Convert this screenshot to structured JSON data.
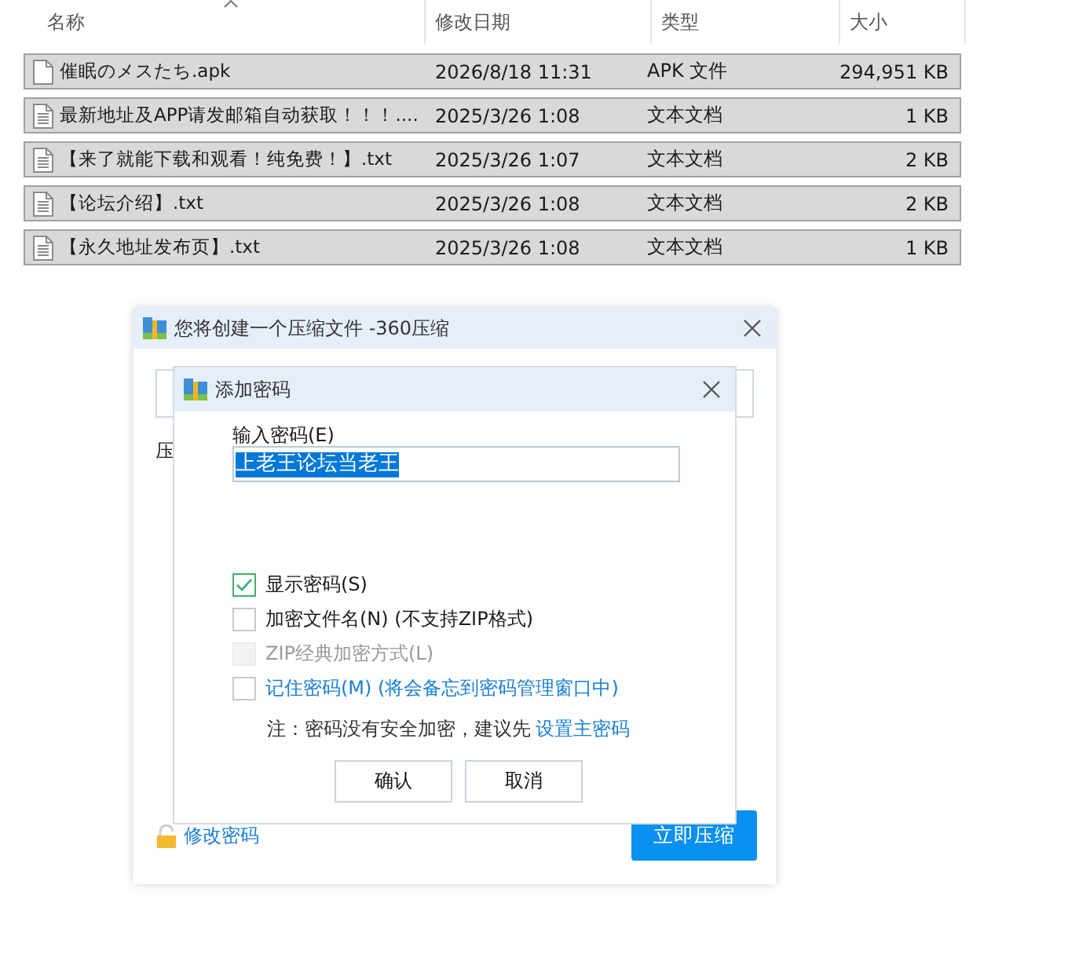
{
  "file_list": {
    "columns": [
      "名称",
      "修改日期",
      "类型",
      "大小"
    ],
    "rows": [
      {
        "name": "催眠のメスたち.apk",
        "date": "2026/8/18 11:31",
        "type": "APK 文件",
        "size": "294,951 KB",
        "selected": true,
        "kind": "blank"
      },
      {
        "name": "最新地址及APP请发邮箱自动获取！！！....",
        "date": "2025/3/26 1:08",
        "type": "文本文档",
        "size": "1 KB",
        "selected": true,
        "kind": "text"
      },
      {
        "name": "【来了就能下载和观看！纯免费！】.txt",
        "date": "2025/3/26 1:07",
        "type": "文本文档",
        "size": "2 KB",
        "selected": true,
        "kind": "text"
      },
      {
        "name": "【论坛介绍】.txt",
        "date": "2025/3/26 1:08",
        "type": "文本文档",
        "size": "2 KB",
        "selected": true,
        "kind": "text"
      },
      {
        "name": "【永久地址发布页】.txt",
        "date": "2025/3/26 1:08",
        "type": "文本文档",
        "size": "1 KB",
        "selected": true,
        "kind": "text"
      }
    ]
  },
  "compress_dialog": {
    "title": "您将创建一个压缩文件 -360压缩",
    "label": "压",
    "change_password_link": "修改密码",
    "compress_button": "立即压缩"
  },
  "password_dialog": {
    "title": "添加密码",
    "password_label": "输入密码(E)",
    "password_value": "上老王论坛当老王",
    "options": [
      {
        "label": "显示密码(S)",
        "checked": true,
        "disabled": false,
        "kind": "plain"
      },
      {
        "label": "加密文件名(N) (不支持ZIP格式)",
        "checked": false,
        "disabled": false,
        "kind": "plain"
      },
      {
        "label": "ZIP经典加密方式(L)",
        "checked": false,
        "disabled": true,
        "kind": "plain"
      },
      {
        "label": "记住密码(M) (将会备忘到密码管理窗口中)",
        "checked": false,
        "disabled": false,
        "kind": "link"
      }
    ],
    "note": "注：密码没有安全加密，建议先",
    "note_link": "设置主密码",
    "buttons": [
      "确认",
      "取消"
    ]
  }
}
